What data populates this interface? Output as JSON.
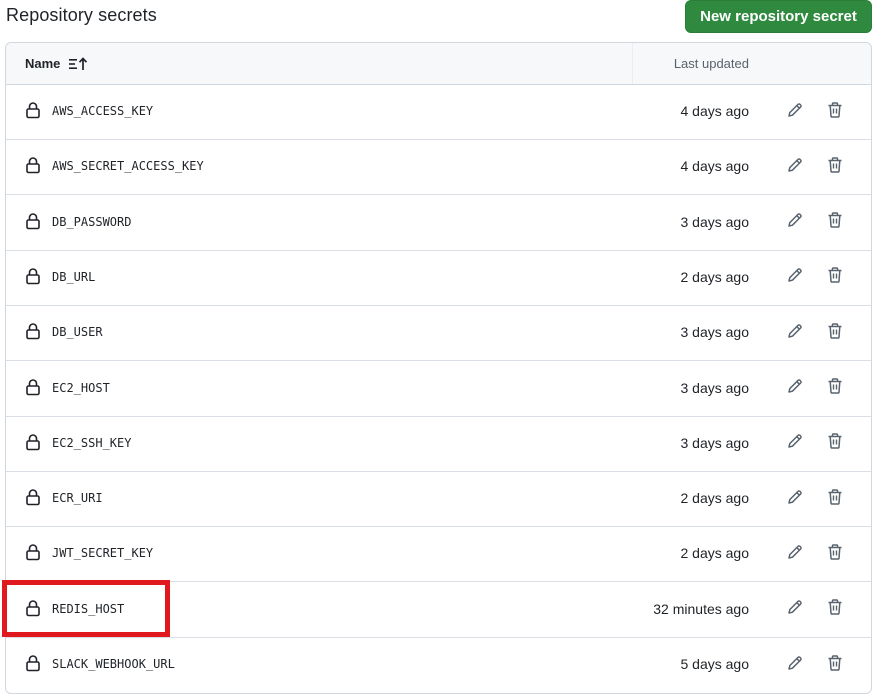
{
  "header": {
    "title": "Repository secrets",
    "new_button_label": "New repository secret"
  },
  "table": {
    "columns": {
      "name": "Name",
      "last_updated": "Last updated"
    },
    "rows": [
      {
        "name": "AWS_ACCESS_KEY",
        "updated": "4 days ago"
      },
      {
        "name": "AWS_SECRET_ACCESS_KEY",
        "updated": "4 days ago"
      },
      {
        "name": "DB_PASSWORD",
        "updated": "3 days ago"
      },
      {
        "name": "DB_URL",
        "updated": "2 days ago"
      },
      {
        "name": "DB_USER",
        "updated": "3 days ago"
      },
      {
        "name": "EC2_HOST",
        "updated": "3 days ago"
      },
      {
        "name": "EC2_SSH_KEY",
        "updated": "3 days ago"
      },
      {
        "name": "ECR_URI",
        "updated": "2 days ago"
      },
      {
        "name": "JWT_SECRET_KEY",
        "updated": "2 days ago"
      },
      {
        "name": "REDIS_HOST",
        "updated": "32 minutes ago"
      },
      {
        "name": "SLACK_WEBHOOK_URL",
        "updated": "5 days ago"
      }
    ]
  },
  "colors": {
    "primary_button": "#2f8a3f",
    "highlight_box": "#e0191f"
  },
  "icons": {
    "row_icon": "lock-icon",
    "edit": "pencil-icon",
    "delete": "trash-icon",
    "sort": "sort-ascending-icon"
  }
}
